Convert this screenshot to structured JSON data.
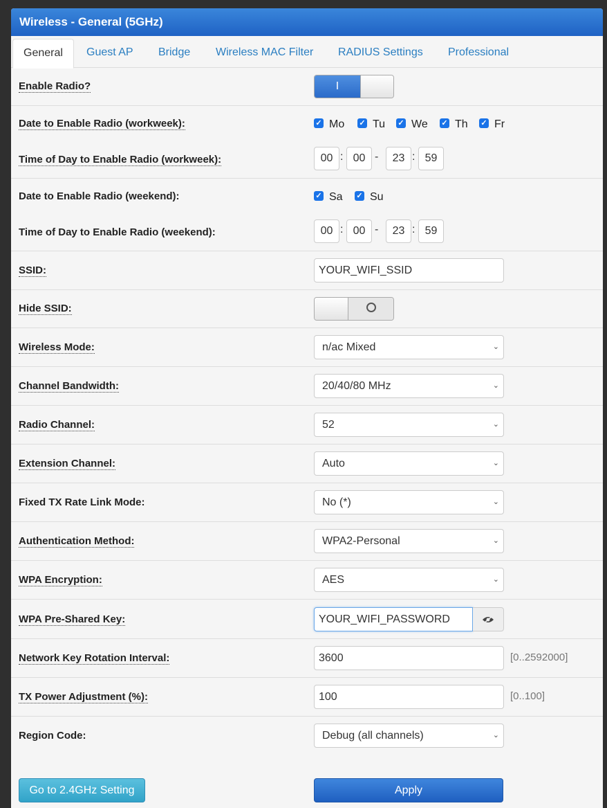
{
  "panel": {
    "title": "Wireless - General (5GHz)"
  },
  "tabs": [
    {
      "label": "General",
      "active": true
    },
    {
      "label": "Guest AP"
    },
    {
      "label": "Bridge"
    },
    {
      "label": "Wireless MAC Filter"
    },
    {
      "label": "RADIUS Settings"
    },
    {
      "label": "Professional"
    }
  ],
  "enable_radio": {
    "label": "Enable Radio?",
    "on_text": "I",
    "state": true
  },
  "workweek_days": {
    "label": "Date to Enable Radio (workweek):",
    "days": [
      {
        "label": "Mo",
        "checked": true
      },
      {
        "label": "Tu",
        "checked": true
      },
      {
        "label": "We",
        "checked": true
      },
      {
        "label": "Th",
        "checked": true
      },
      {
        "label": "Fr",
        "checked": true
      }
    ]
  },
  "workweek_time": {
    "label": "Time of Day to Enable Radio (workweek):",
    "start_h": "00",
    "start_m": "00",
    "end_h": "23",
    "end_m": "59"
  },
  "weekend_days": {
    "label": "Date to Enable Radio (weekend):",
    "days": [
      {
        "label": "Sa",
        "checked": true
      },
      {
        "label": "Su",
        "checked": true
      }
    ]
  },
  "weekend_time": {
    "label": "Time of Day to Enable Radio (weekend):",
    "start_h": "00",
    "start_m": "00",
    "end_h": "23",
    "end_m": "59"
  },
  "time_sep": {
    "colon": ":",
    "dash": "-"
  },
  "ssid": {
    "label": "SSID:",
    "value": "YOUR_WIFI_SSID"
  },
  "hide_ssid": {
    "label": "Hide SSID:",
    "state": false
  },
  "wireless_mode": {
    "label": "Wireless Mode:",
    "value": "n/ac Mixed"
  },
  "channel_bandwidth": {
    "label": "Channel Bandwidth:",
    "value": "20/40/80 MHz"
  },
  "radio_channel": {
    "label": "Radio Channel:",
    "value": "52"
  },
  "extension_channel": {
    "label": "Extension Channel:",
    "value": "Auto"
  },
  "fixed_tx_rate": {
    "label": "Fixed TX Rate Link Mode:",
    "value": "No (*)"
  },
  "auth_method": {
    "label": "Authentication Method:",
    "value": "WPA2-Personal"
  },
  "wpa_encryption": {
    "label": "WPA Encryption:",
    "value": "AES"
  },
  "wpa_psk": {
    "label": "WPA Pre-Shared Key:",
    "value": "YOUR_WIFI_PASSWORD",
    "icon": "eye-icon"
  },
  "key_rotation": {
    "label": "Network Key Rotation Interval:",
    "value": "3600",
    "hint": "[0..2592000]"
  },
  "tx_power": {
    "label": "TX Power Adjustment (%):",
    "value": "100",
    "hint": "[0..100]"
  },
  "region_code": {
    "label": "Region Code:",
    "value": "Debug (all channels)"
  },
  "buttons": {
    "go_24": "Go to 2.4GHz Setting",
    "apply": "Apply"
  },
  "colors": {
    "header": "#2b73d3",
    "link": "#2a7ec1",
    "checkbox": "#1a73e8",
    "apply": "#2a6acc",
    "go_button": "#46b3d6"
  }
}
